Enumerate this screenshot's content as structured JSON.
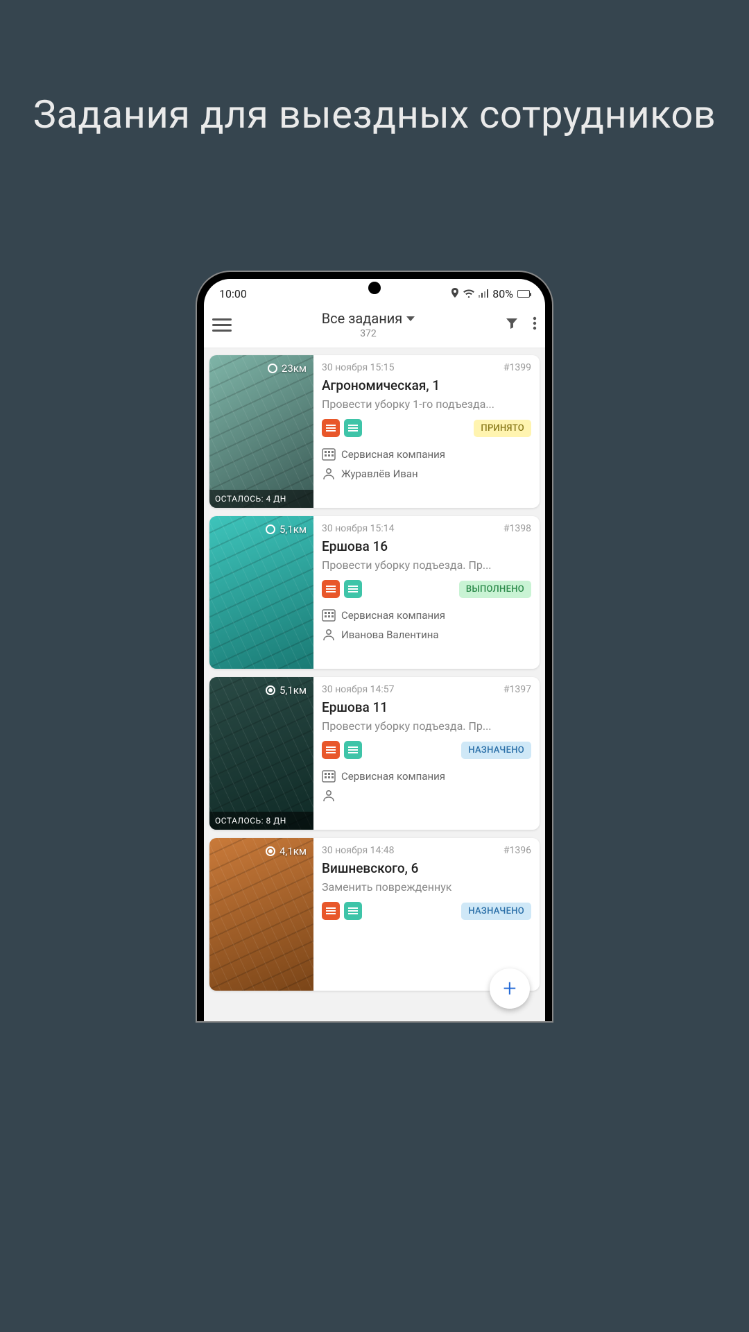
{
  "promo": {
    "title": "Задания для выездных сотрудников"
  },
  "statusbar": {
    "time": "10:00",
    "battery_pct": "80%"
  },
  "appbar": {
    "title": "Все задания",
    "count": "372"
  },
  "status_colors": {
    "accepted": {
      "bg": "#fff4b0",
      "fg": "#8a7a1a"
    },
    "done": {
      "bg": "#c9f3d4",
      "fg": "#2b8a4a"
    },
    "assigned": {
      "bg": "#cfe8f7",
      "fg": "#2a6fa8"
    }
  },
  "tasks": [
    {
      "distance": "23км",
      "dot_fill": false,
      "remaining": "ОСТАЛОСЬ:  4 ДН",
      "datetime": "30 ноября 15:15",
      "number": "#1399",
      "address": "Агрономическая, 1",
      "description": "Провести уборку 1-го подъезда...",
      "status": "ПРИНЯТО",
      "status_key": "accepted",
      "company": "Сервисная компания",
      "assignee": "Журавлёв Иван",
      "thumb_class": ""
    },
    {
      "distance": "5,1км",
      "dot_fill": false,
      "remaining": "",
      "datetime": "30 ноября 15:14",
      "number": "#1398",
      "address": "Ершова 16",
      "description": "Провести уборку подъезда. Пр...",
      "status": "ВЫПОЛНЕНО",
      "status_key": "done",
      "company": "Сервисная компания",
      "assignee": "Иванова Валентина",
      "thumb_class": "teal"
    },
    {
      "distance": "5,1км",
      "dot_fill": true,
      "remaining": "ОСТАЛОСЬ:  8 ДН",
      "datetime": "30 ноября 14:57",
      "number": "#1397",
      "address": "Ершова 11",
      "description": "Провести уборку подъезда. Пр...",
      "status": "НАЗНАЧЕНО",
      "status_key": "assigned",
      "company": "Сервисная компания",
      "assignee": "",
      "thumb_class": "dark"
    },
    {
      "distance": "4,1км",
      "dot_fill": true,
      "remaining": "",
      "datetime": "30 ноября 14:48",
      "number": "#1396",
      "address": "Вишневского, 6",
      "description": "Заменить поврежденнук",
      "status": "НАЗНАЧЕНО",
      "status_key": "assigned",
      "company": "",
      "assignee": "",
      "thumb_class": "bench"
    }
  ],
  "fab": {
    "glyph": "+"
  }
}
